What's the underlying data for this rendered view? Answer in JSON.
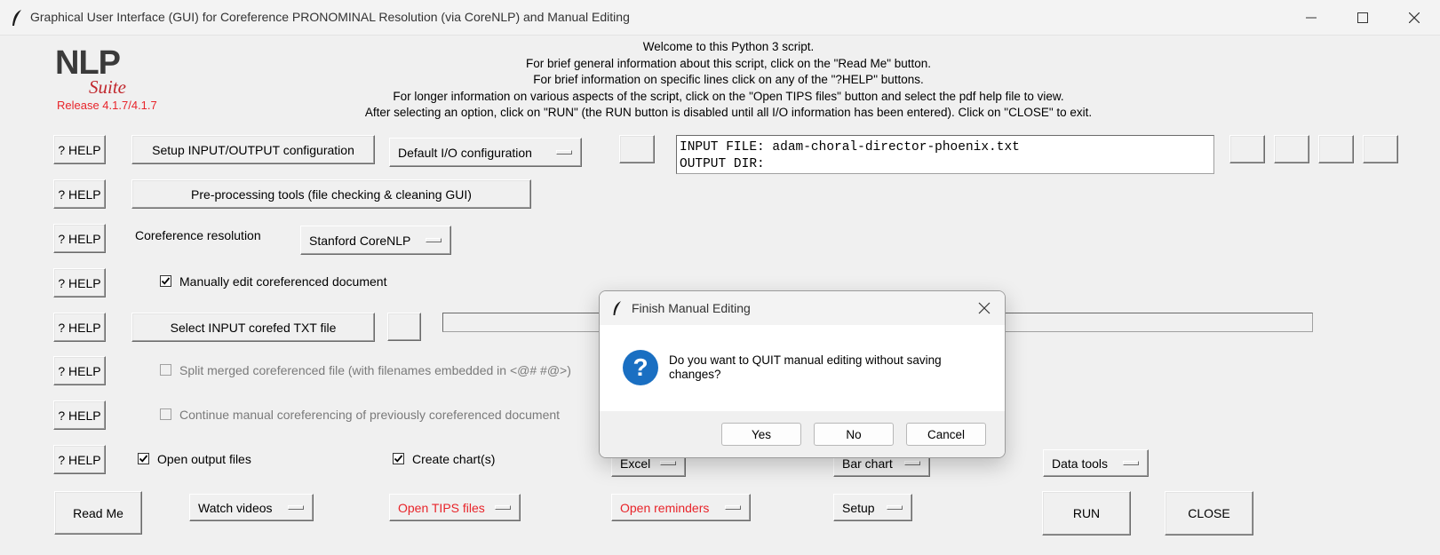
{
  "window": {
    "title": "Graphical User Interface (GUI) for Coreference PRONOMINAL Resolution (via CoreNLP) and Manual Editing"
  },
  "logo": {
    "nlp": "NLP",
    "suite": "Suite",
    "release": "Release 4.1.7/4.1.7"
  },
  "welcome": [
    "Welcome to this Python 3 script.",
    "For brief general information about this script, click on the \"Read Me\" button.",
    "For brief information on specific lines click on any of the \"?HELP\" buttons.",
    "For longer information on various aspects of the script, click on the \"Open TIPS files\" button and select the pdf help file to view.",
    "After selecting an option, click on \"RUN\" (the RUN button is disabled until all I/O information has been entered).   Click on \"CLOSE\" to exit."
  ],
  "help_label": "? HELP",
  "row1": {
    "setup_button": "Setup INPUT/OUTPUT configuration",
    "config_menu": "Default I/O configuration",
    "input_file": "INPUT FILE: adam-choral-director-phoenix.txt",
    "output_dir": "OUTPUT DIR:"
  },
  "row2": {
    "preprocess_button": "Pre-processing tools (file checking & cleaning GUI)"
  },
  "row3": {
    "label": "Coreference resolution",
    "menu": "Stanford CoreNLP"
  },
  "row4": {
    "checkbox_label": "Manually edit coreferenced document",
    "checked": true
  },
  "row5": {
    "select_button": "Select INPUT corefed TXT file"
  },
  "row6": {
    "checkbox_label": "Split merged coreferenced file (with filenames embedded in <@# #@>)"
  },
  "row7": {
    "checkbox_label": "Continue manual coreferencing of previously coreferenced document"
  },
  "row8": {
    "open_output_label": "Open output files",
    "create_charts_label": "Create chart(s)",
    "excel_menu": "Excel",
    "bar_chart_menu": "Bar chart",
    "data_tools_menu": "Data tools"
  },
  "bottom": {
    "read_me": "Read Me",
    "watch_videos": "Watch videos",
    "open_tips": "Open TIPS files",
    "open_reminders": "Open reminders",
    "setup": "Setup",
    "run": "RUN",
    "close": "CLOSE"
  },
  "dialog": {
    "title": "Finish Manual Editing",
    "message": "Do you want to QUIT manual editing without saving changes?",
    "yes": "Yes",
    "no": "No",
    "cancel": "Cancel"
  },
  "colors": {
    "accent_red": "#e8242a",
    "question_blue": "#1a6fc2"
  },
  "icons": [
    "feather-icon",
    "minimize-icon",
    "maximize-icon",
    "close-icon",
    "question-icon"
  ]
}
